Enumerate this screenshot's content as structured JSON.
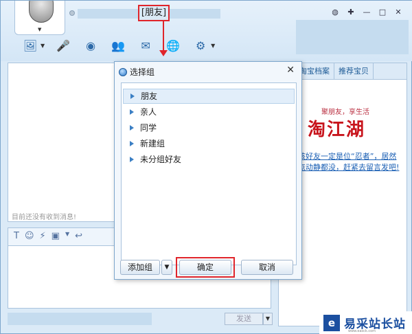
{
  "title_bar": {
    "contact_name": "[朋友]",
    "window_controls": [
      "◍",
      "✚",
      "—",
      "□",
      "✕"
    ]
  },
  "toolbar": {
    "icons": [
      "send-file-icon",
      "voice-icon",
      "webcam-icon",
      "group-icon",
      "mail-icon",
      "browser-icon",
      "apps-icon"
    ]
  },
  "chat": {
    "status_text": "目前还没有收到消息!"
  },
  "input_toolbar": {
    "icons": [
      "font-icon",
      "emoji-icon",
      "shake-icon",
      "screenshot-icon",
      "history-icon"
    ]
  },
  "send_button": {
    "label": "发送"
  },
  "sidebar": {
    "tabs": [
      "湖",
      "淘宝档案",
      "推荐宝贝"
    ],
    "tagline": "聚朋友，享生活",
    "logo_text": "淘江湖",
    "promo_text": "该好友一定是位“忍者”，居然点动静都没，赶紧去留言发吧!"
  },
  "dialog": {
    "title": "选择组",
    "close": "✕",
    "groups": [
      {
        "label": "朋友",
        "selected": true
      },
      {
        "label": "亲人",
        "selected": false
      },
      {
        "label": "同学",
        "selected": false
      },
      {
        "label": "新建组",
        "selected": false
      },
      {
        "label": "未分组好友",
        "selected": false
      }
    ],
    "add_group_label": "添加组",
    "dropdown_arrow": "▼",
    "confirm_label": "确定",
    "cancel_label": "取消"
  },
  "watermark": {
    "text": "易采站长站",
    "url": "www.easck.com"
  },
  "colors": {
    "highlight_red": "#e0242a",
    "window_blue": "#dbeaf7",
    "logo_red": "#c8141c"
  }
}
